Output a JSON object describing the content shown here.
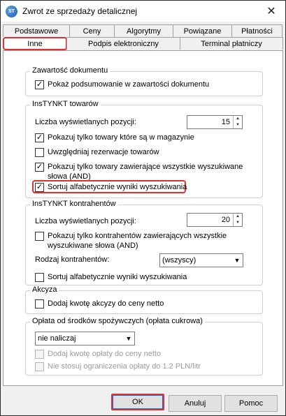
{
  "window": {
    "title": "Zwrot ze sprzedaży detalicznej",
    "icon_text": "ST",
    "close_glyph": "✕"
  },
  "tabs": {
    "row1": [
      "Podstawowe",
      "Ceny",
      "Algorytmy",
      "Powiązane",
      "Płatności"
    ],
    "row2": [
      "Inne",
      "Podpis elektroniczny",
      "Terminal płatniczy"
    ],
    "active": "Inne"
  },
  "doc_group": {
    "title": "Zawartość dokumentu",
    "items": [
      {
        "label": "Pokaż podsumowanie w zawartości dokumentu",
        "checked": true
      }
    ]
  },
  "towary_group": {
    "title": "InsTYNKT towarów",
    "count_label": "Liczba wyświetlanych pozycji:",
    "count_value": "15",
    "items": [
      {
        "label": "Pokazuj tylko towary które są w magazynie",
        "checked": true
      },
      {
        "label": "Uwzględniaj rezerwacje towarów",
        "checked": false
      },
      {
        "label": "Pokazuj tylko towary zawierające wszystkie wyszukiwane słowa (AND)",
        "checked": true
      },
      {
        "label": "Sortuj alfabetycznie wyniki wyszukiwania",
        "checked": true
      }
    ]
  },
  "kontrahenci_group": {
    "title": "InsTYNKT kontrahentów",
    "count_label": "Liczba wyświetlanych pozycji:",
    "count_value": "20",
    "items": [
      {
        "label": "Pokazuj tylko kontrahentów zawierających wszystkie wyszukiwane słowa (AND)",
        "checked": false
      },
      {
        "label": "Sortuj alfabetycznie wyniki wyszukiwania",
        "checked": false
      }
    ],
    "type_label": "Rodzaj kontrahentów:",
    "type_value": "(wszyscy)"
  },
  "akcyza_group": {
    "title": "Akcyza",
    "items": [
      {
        "label": "Dodaj kwotę akcyzy do ceny netto",
        "checked": false
      }
    ]
  },
  "oplata_group": {
    "title": "Opłata od środków spożywczych (opłata cukrowa)",
    "select_value": "nie naliczaj",
    "items": [
      {
        "label": "Dodaj kwotę opłaty do ceny netto",
        "checked": false,
        "disabled": true
      },
      {
        "label": "Nie stosuj ograniczenia opłaty do 1.2 PLN/litr",
        "checked": false,
        "disabled": true
      }
    ]
  },
  "buttons": {
    "ok": "OK",
    "cancel": "Anuluj",
    "help": "Pomoc"
  },
  "glyphs": {
    "check": "✓",
    "spin_up": "▲",
    "spin_down": "▼",
    "combo_arrow": "▼"
  },
  "colors": {
    "highlight": "#e03030",
    "panel": "#ffffff",
    "chrome": "#f0f0f0"
  }
}
